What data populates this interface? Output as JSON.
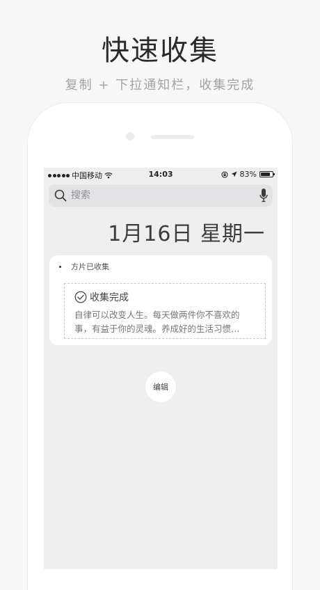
{
  "promo": {
    "title": "快速收集",
    "subtitle": "复制 + 下拉通知栏，收集完成"
  },
  "status_bar": {
    "carrier": "中国移动",
    "time": "14:03",
    "battery": "83%",
    "battery_level": 0.83
  },
  "search": {
    "placeholder": "搜索"
  },
  "date": {
    "label": "1月16日 星期一"
  },
  "widget": {
    "name": "方片已收集",
    "collected_title": "收集完成",
    "collected_text": "自律可以改变人生。每天做两件你不喜欢的事，有益于你的灵魂。养成好的生活习惯…"
  },
  "edit": {
    "label": "编辑"
  }
}
